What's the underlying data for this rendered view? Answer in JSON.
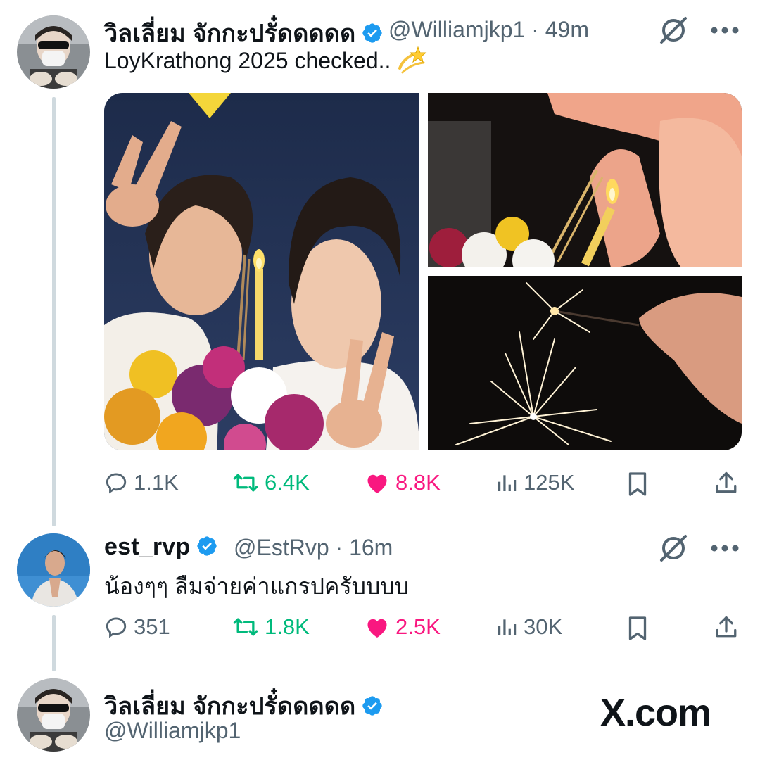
{
  "tweet1": {
    "author_name": "วิลเลี่ยม จักกะปรั๋ดดดดด",
    "handle_time": "@Williamjkp1 · 49m",
    "text": "LoyKrathong 2025 checked..",
    "emoji_icon": "dizzy-star-icon",
    "stats": {
      "replies": "1.1K",
      "reposts": "6.4K",
      "likes": "8.8K",
      "views": "125K"
    }
  },
  "tweet2": {
    "author_name": "est_rvp",
    "handle_time": "@EstRvp · 16m",
    "text": "น้องๆๆ ลืมจ่ายค่าแกรปครับบบบ",
    "stats": {
      "replies": "351",
      "reposts": "1.8K",
      "likes": "2.5K",
      "views": "30K"
    }
  },
  "footer": {
    "author_name": "วิลเลี่ยม จักกะปรั๋ดดดดด",
    "handle": "@Williamjkp1",
    "brand": "X.com"
  },
  "colors": {
    "text": "#0f1419",
    "secondary": "#536471",
    "verified": "#1d9bf0",
    "repost": "#00ba7c",
    "like": "#f91880",
    "thread_line": "#cfd9de"
  }
}
